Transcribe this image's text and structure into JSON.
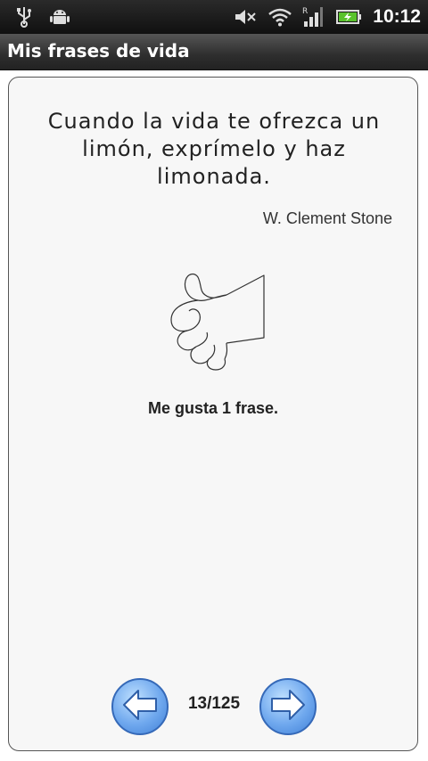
{
  "status_bar": {
    "time": "10:12",
    "icons": [
      "usb-icon",
      "android-debug-icon",
      "mute-icon",
      "wifi-icon",
      "signal-icon",
      "battery-icon"
    ]
  },
  "app": {
    "title": "Mis frases de vida"
  },
  "quote": {
    "text": "Cuando la vida te ofrezca un limón, exprímelo y haz limonada.",
    "author": "W. Clement Stone"
  },
  "likes": {
    "label": "Me gusta 1 frase."
  },
  "pager": {
    "counter": "13/125"
  },
  "colors": {
    "button_blue": "#6fa8ee",
    "card_background": "#f7f7f7",
    "title_bar": "#333333"
  }
}
